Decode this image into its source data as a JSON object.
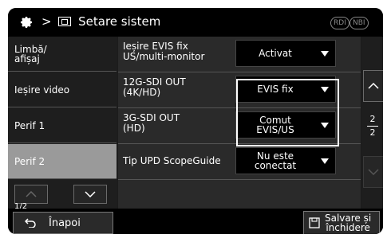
{
  "header": {
    "breadcrumb_separator": ">",
    "title": "Setare sistem",
    "indicators": [
      "RDI",
      "NBI"
    ]
  },
  "sidebar": {
    "items": [
      {
        "label_line1": "Limbă/",
        "label_line2": "afișaj",
        "active": false
      },
      {
        "label_line1": "Ieșire video",
        "label_line2": "",
        "active": false
      },
      {
        "label_line1": "Perif 1",
        "label_line2": "",
        "active": false
      },
      {
        "label_line1": "Perif 2",
        "label_line2": "",
        "active": true
      }
    ],
    "page": "1/2"
  },
  "settings": [
    {
      "label_line1": "Ieșire EVIS fix",
      "label_line2": "US/multi-monitor",
      "value_line1": "Activat",
      "value_line2": ""
    },
    {
      "label_line1": "12G-SDI OUT",
      "label_line2": "(4K/HD)",
      "value_line1": "EVIS fix",
      "value_line2": ""
    },
    {
      "label_line1": "3G-SDI OUT",
      "label_line2": "(HD)",
      "value_line1": "Comut",
      "value_line2": "EVIS/US"
    },
    {
      "label_line1": "Tip UPD ScopeGuide",
      "label_line2": "",
      "value_line1": "Nu este",
      "value_line2": "conectat"
    }
  ],
  "scroll": {
    "current": "2",
    "total": "2"
  },
  "footer": {
    "back_label": "Înapoi",
    "save_line1": "Salvare și",
    "save_line2": "închidere"
  }
}
